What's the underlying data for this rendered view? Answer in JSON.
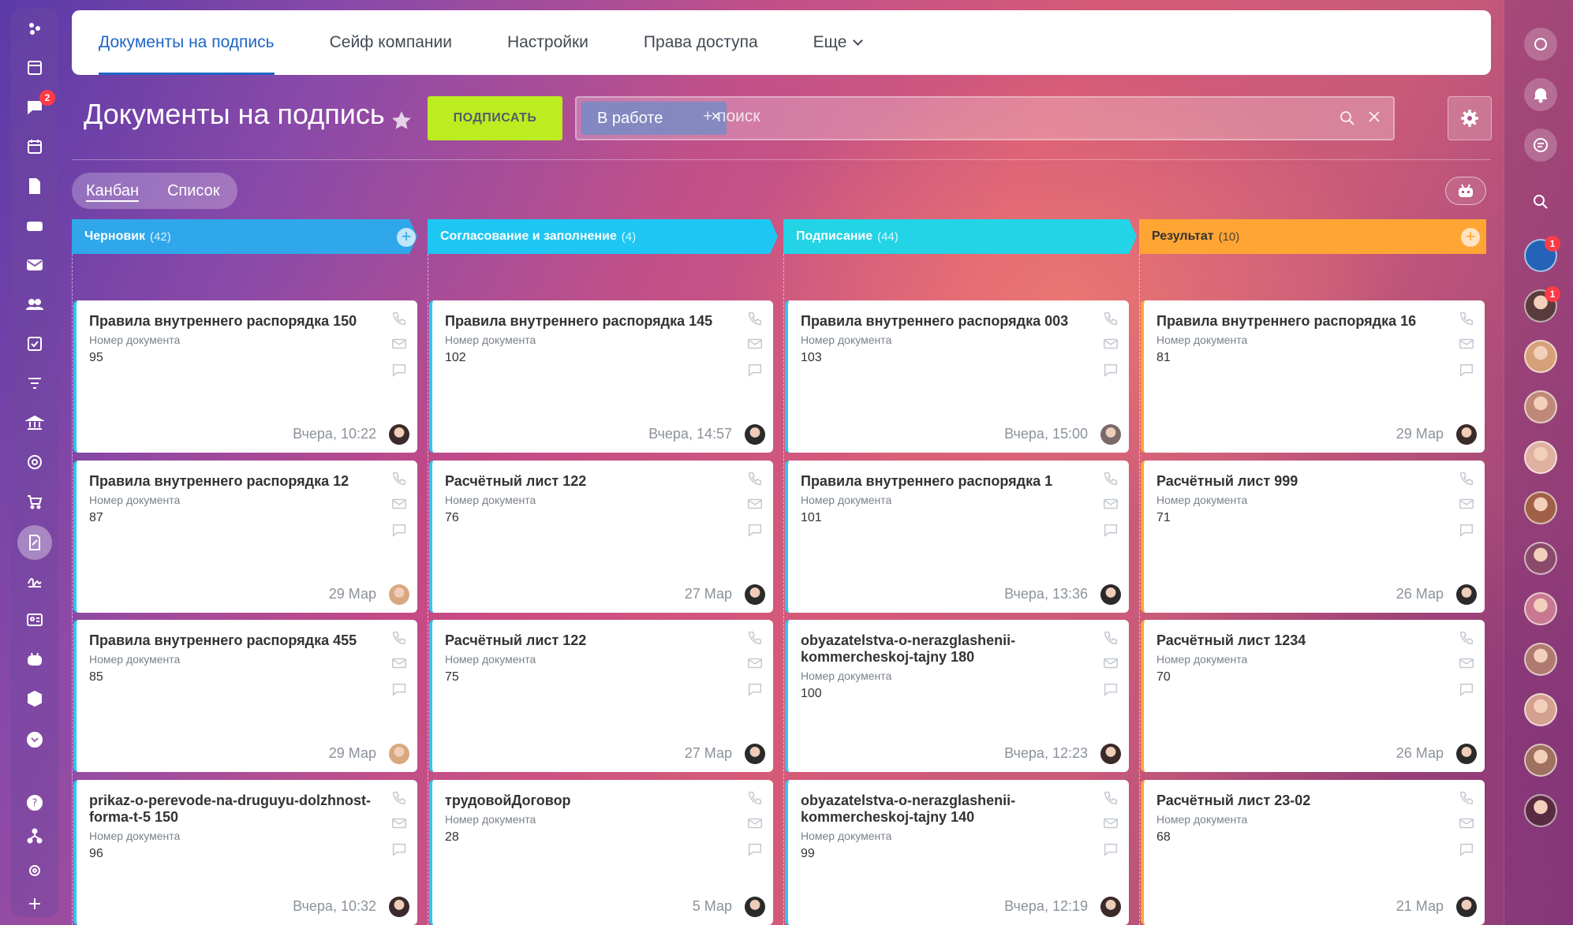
{
  "tabs": [
    {
      "label": "Документы на подпись",
      "active": true
    },
    {
      "label": "Сейф компании",
      "active": false
    },
    {
      "label": "Настройки",
      "active": false
    },
    {
      "label": "Права доступа",
      "active": false
    },
    {
      "label": "Еще",
      "active": false
    }
  ],
  "header": {
    "title": "Документы на подпись",
    "sign_button": "ПОДПИСАТЬ",
    "filter_chip": "В работе",
    "search_placeholder": "+ поиск"
  },
  "views": {
    "kanban": "Канбан",
    "list": "Список",
    "active": "kanban"
  },
  "notifications": {
    "chat_badge": "2",
    "right_badge_1": "1",
    "right_badge_2": "1"
  },
  "columns": [
    {
      "name": "Черновик",
      "count": "(42)",
      "color": "#2fa7ea",
      "border": "#2fc6f6",
      "cards": [
        {
          "title": "Правила внутреннего распорядка 150",
          "label": "Номер документа",
          "value": "95",
          "date": "Вчера, 10:22"
        },
        {
          "title": "Правила внутреннего распорядка 12",
          "label": "Номер документа",
          "value": "87",
          "date": "29 Мар"
        },
        {
          "title": "Правила внутреннего распорядка 455",
          "label": "Номер документа",
          "value": "85",
          "date": "29 Мар"
        },
        {
          "title": "prikaz-o-perevode-na-druguyu-dolzhnost-forma-t-5 150",
          "label": "Номер документа",
          "value": "96",
          "date": "Вчера, 10:32"
        }
      ]
    },
    {
      "name": "Согласование и заполнение",
      "count": "(4)",
      "color": "#1ec6f4",
      "border": "#2fc6f6",
      "cards": [
        {
          "title": "Правила внутреннего распорядка 145",
          "label": "Номер документа",
          "value": "102",
          "date": "Вчера, 14:57"
        },
        {
          "title": "Расчётный лист 122",
          "label": "Номер документа",
          "value": "76",
          "date": "27 Мар"
        },
        {
          "title": "Расчётный лист 122",
          "label": "Номер документа",
          "value": "75",
          "date": "27 Мар"
        },
        {
          "title": "трудовойДоговор",
          "label": "Номер документа",
          "value": "28",
          "date": "5 Мар"
        }
      ]
    },
    {
      "name": "Подписание",
      "count": "(44)",
      "color": "#22d4e6",
      "border": "#2fc6f6",
      "cards": [
        {
          "title": "Правила внутреннего распорядка 003",
          "label": "Номер документа",
          "value": "103",
          "date": "Вчера, 15:00"
        },
        {
          "title": "Правила внутреннего распорядка 1",
          "label": "Номер документа",
          "value": "101",
          "date": "Вчера, 13:36"
        },
        {
          "title": "obyazatelstva-o-nerazglashenii-kommercheskoj-tajny 180",
          "label": "Номер документа",
          "value": "100",
          "date": "Вчера, 12:23"
        },
        {
          "title": "obyazatelstva-o-nerazglashenii-kommercheskoj-tajny 140",
          "label": "Номер документа",
          "value": "99",
          "date": "Вчера, 12:19"
        }
      ]
    },
    {
      "name": "Результат",
      "count": "(10)",
      "color": "#ffa534",
      "border": "#ffa534",
      "cards": [
        {
          "title": "Правила внутреннего распорядка 16",
          "label": "Номер документа",
          "value": "81",
          "date": "29 Мар"
        },
        {
          "title": "Расчётный лист 999",
          "label": "Номер документа",
          "value": "71",
          "date": "26 Мар"
        },
        {
          "title": "Расчётный лист 1234",
          "label": "Номер документа",
          "value": "70",
          "date": "26 Мар"
        },
        {
          "title": "Расчётный лист 23-02",
          "label": "Номер документа",
          "value": "68",
          "date": "21 Мар"
        }
      ]
    }
  ]
}
